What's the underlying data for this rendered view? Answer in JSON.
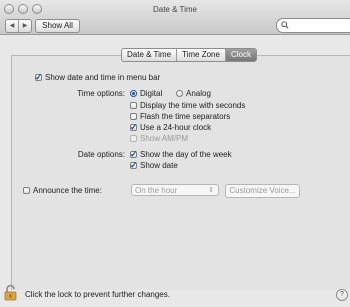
{
  "window": {
    "title": "Date & Time",
    "show_all_label": "Show All",
    "back_arrow": "◀",
    "forward_arrow": "▶",
    "search_placeholder": ""
  },
  "tabs": [
    {
      "label": "Date & Time",
      "active": false
    },
    {
      "label": "Time Zone",
      "active": false
    },
    {
      "label": "Clock",
      "active": true
    }
  ],
  "clock": {
    "show_menu_bar": {
      "label": "Show date and time in menu bar",
      "checked": true
    },
    "time_options_label": "Time options:",
    "digital_label": "Digital",
    "analog_label": "Analog",
    "display_seconds": {
      "label": "Display the time with seconds",
      "checked": false
    },
    "flash_separators": {
      "label": "Flash the time separators",
      "checked": false
    },
    "use_24_hour": {
      "label": "Use a 24-hour clock",
      "checked": true
    },
    "show_ampm": {
      "label": "Show AM/PM",
      "checked": false,
      "disabled": true
    },
    "date_options_label": "Date options:",
    "show_day": {
      "label": "Show the day of the week",
      "checked": true
    },
    "show_date": {
      "label": "Show date",
      "checked": true
    },
    "announce": {
      "label": "Announce the time:",
      "checked": false
    },
    "announce_interval": "On the hour",
    "customize_voice": "Customize Voice..."
  },
  "footer": {
    "lock_text": "Click the lock to prevent further changes.",
    "help_label": "?"
  },
  "icons": {
    "lock": "lock-icon",
    "help": "help-icon",
    "search": "search-icon"
  },
  "colors": {
    "accent": "#1f4f9c"
  }
}
